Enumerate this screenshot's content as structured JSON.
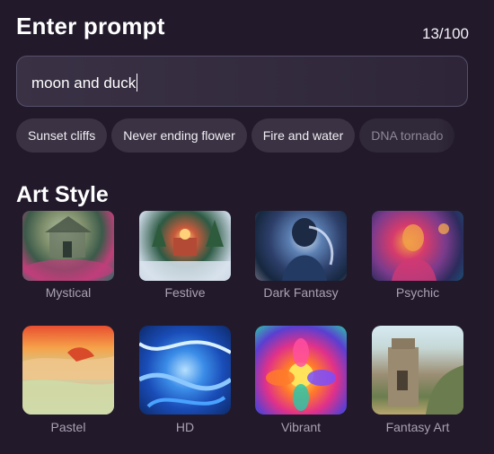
{
  "header": {
    "title": "Enter prompt",
    "counter": "13/100"
  },
  "prompt": {
    "value": "moon and duck"
  },
  "suggestions": [
    "Sunset cliffs",
    "Never ending flower",
    "Fire and water",
    "DNA tornado"
  ],
  "art_style": {
    "title": "Art Style",
    "styles": [
      {
        "label": "Mystical",
        "image": "mystical-temple-art"
      },
      {
        "label": "Festive",
        "image": "festive-winter-village-art"
      },
      {
        "label": "Dark Fantasy",
        "image": "dark-fantasy-figure-art"
      },
      {
        "label": "Psychic",
        "image": "psychic-glowing-figure-art"
      },
      {
        "label": "Pastel",
        "image": "pastel-landscape-art"
      },
      {
        "label": "HD",
        "image": "hd-blue-abstract-art"
      },
      {
        "label": "Vibrant",
        "image": "vibrant-flower-art"
      },
      {
        "label": "Fantasy Art",
        "image": "fantasy-tower-art"
      }
    ]
  },
  "colors": {
    "background": "#221a2b",
    "chip": "#3b3344",
    "label": "#a9a2b3"
  }
}
